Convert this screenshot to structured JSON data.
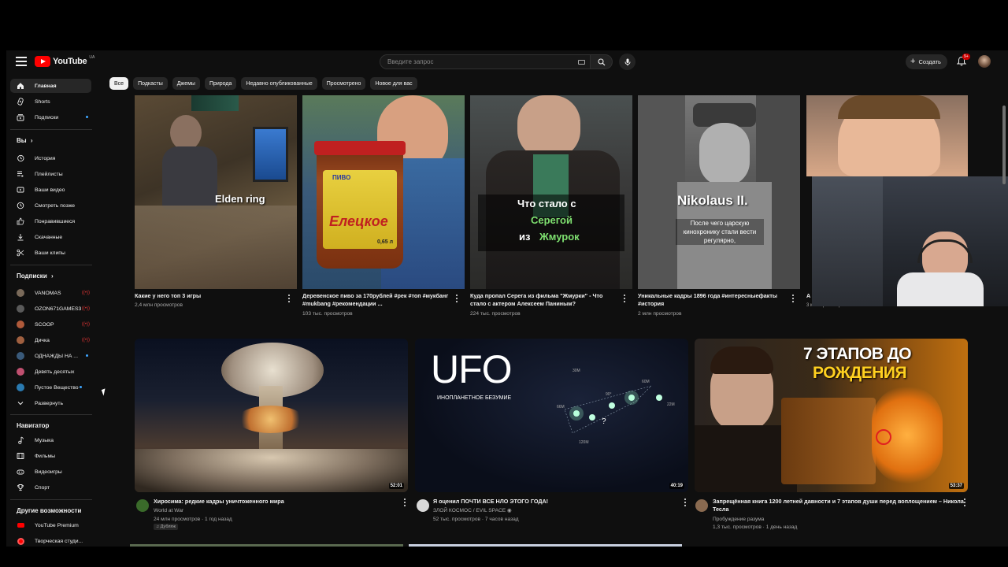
{
  "header": {
    "logo_text": "YouTube",
    "logo_region": "UA",
    "search_placeholder": "Введите запрос",
    "create_label": "Создать",
    "notif_count": "9+"
  },
  "sidebar": {
    "top_items": [
      {
        "label": "Главная",
        "icon": "home-icon"
      },
      {
        "label": "Shorts",
        "icon": "shorts-icon"
      },
      {
        "label": "Подписки",
        "icon": "subscriptions-icon"
      }
    ],
    "you_title": "Вы",
    "you_items": [
      {
        "label": "История",
        "icon": "history-icon"
      },
      {
        "label": "Плейлисты",
        "icon": "playlists-icon"
      },
      {
        "label": "Ваши видео",
        "icon": "your-videos-icon"
      },
      {
        "label": "Смотреть позже",
        "icon": "watch-later-icon"
      },
      {
        "label": "Понравившиеся",
        "icon": "like-icon"
      },
      {
        "label": "Скачанные",
        "icon": "download-icon"
      },
      {
        "label": "Ваши клипы",
        "icon": "scissors-icon"
      }
    ],
    "subs_title": "Подписки",
    "subs_items": [
      {
        "label": "VANOMAS",
        "color": "#7a6a5a"
      },
      {
        "label": "OZON671GAMES3",
        "color": "#5a5a5a"
      },
      {
        "label": "SCOOP",
        "color": "#b05a3a"
      },
      {
        "label": "Дичка",
        "color": "#a06040"
      },
      {
        "label": "ОДНАЖДЫ НА ...",
        "color": "#3a5a7a"
      },
      {
        "label": "Девять десятых",
        "color": "#c05070"
      },
      {
        "label": "Пустое Вещество",
        "color": "#2a7ab0"
      },
      {
        "label": "Развернуть",
        "icon": "chevron-down-icon"
      }
    ],
    "nav_title": "Навигатор",
    "nav_items": [
      {
        "label": "Музыка",
        "icon": "music-icon"
      },
      {
        "label": "Фильмы",
        "icon": "film-icon"
      },
      {
        "label": "Видеоигры",
        "icon": "gamepad-icon"
      },
      {
        "label": "Спорт",
        "icon": "trophy-icon"
      }
    ],
    "more_title": "Другие возможности",
    "more_items": [
      {
        "label": "YouTube Premium",
        "icon": "youtube-premium-icon"
      },
      {
        "label": "Творческая студи...",
        "icon": "studio-icon"
      }
    ]
  },
  "chips": [
    "Все",
    "Подкасты",
    "Джемы",
    "Природа",
    "Недавно опубликованные",
    "Просмотрено",
    "Новое для вас"
  ],
  "row1": [
    {
      "title": "Какие у него топ 3 игры",
      "meta": "2,4 млн просмотров",
      "overlay": "Elden ring"
    },
    {
      "title": "Деревенское пиво за 170рублей #рек #топ #мукбанг #mukbang #рекомендации ...",
      "meta": "103 тыс. просмотров",
      "overlay_brand": "Елецкое",
      "overlay_sub": "ПИВО",
      "overlay_vol": "0,65 л"
    },
    {
      "title": "Куда пропал  Серега из фильма \"Жмурки\" - Что стало с актером Алексеем Паниным?",
      "meta": "224 тыс. просмотров",
      "overlay_l1": "Что стало с",
      "overlay_l2": "Серегой",
      "overlay_l3a": "из",
      "overlay_l3b": "Жмурок"
    },
    {
      "title": "Уникальные кадры 1896 года #интересныефакты #история",
      "meta": "2 млн просмотров",
      "overlay": "Nikolaus II.",
      "overlay_sub": "После чего царскую кинохронику стали вести регулярно,"
    },
    {
      "title": "А",
      "meta": "3 млн просмотров"
    }
  ],
  "row2": [
    {
      "title": "Хиросима: редкие кадры уничтоженного мира",
      "channel": "World at War",
      "meta": "24 млн просмотров · 1 год назад",
      "duration": "52:01",
      "badge": "Дубляж"
    },
    {
      "title": "Я оценил ПОЧТИ ВСЕ НЛО ЭТОГО ГОДА!",
      "channel": "ЗЛОЙ КОСМОС / EVIL SPACE",
      "meta": "52 тыс. просмотров · 7 часов назад",
      "duration": "40:19",
      "overlay": "UFO",
      "overlay_sub": "ИНОПЛАНЕТНОЕ БЕЗУМИЕ",
      "labels": [
        "60M",
        "66M",
        "30M",
        "90°",
        "?",
        "120M",
        "22M"
      ]
    },
    {
      "title": "Запрещённая книга 1200 летней давности и 7 этапов души перед воплощением – Никола Тесла",
      "channel": "Пробуждение разума",
      "meta": "1,3 тыс. просмотров · 1 день назад",
      "duration": "53:37",
      "overlay_l1": "7 ЭТАПОВ ДО",
      "overlay_l2": "РОЖДЕНИЯ"
    }
  ],
  "colors": {
    "bg": "#0f0f0f",
    "accent": "#ff0000",
    "chip": "#272727"
  }
}
